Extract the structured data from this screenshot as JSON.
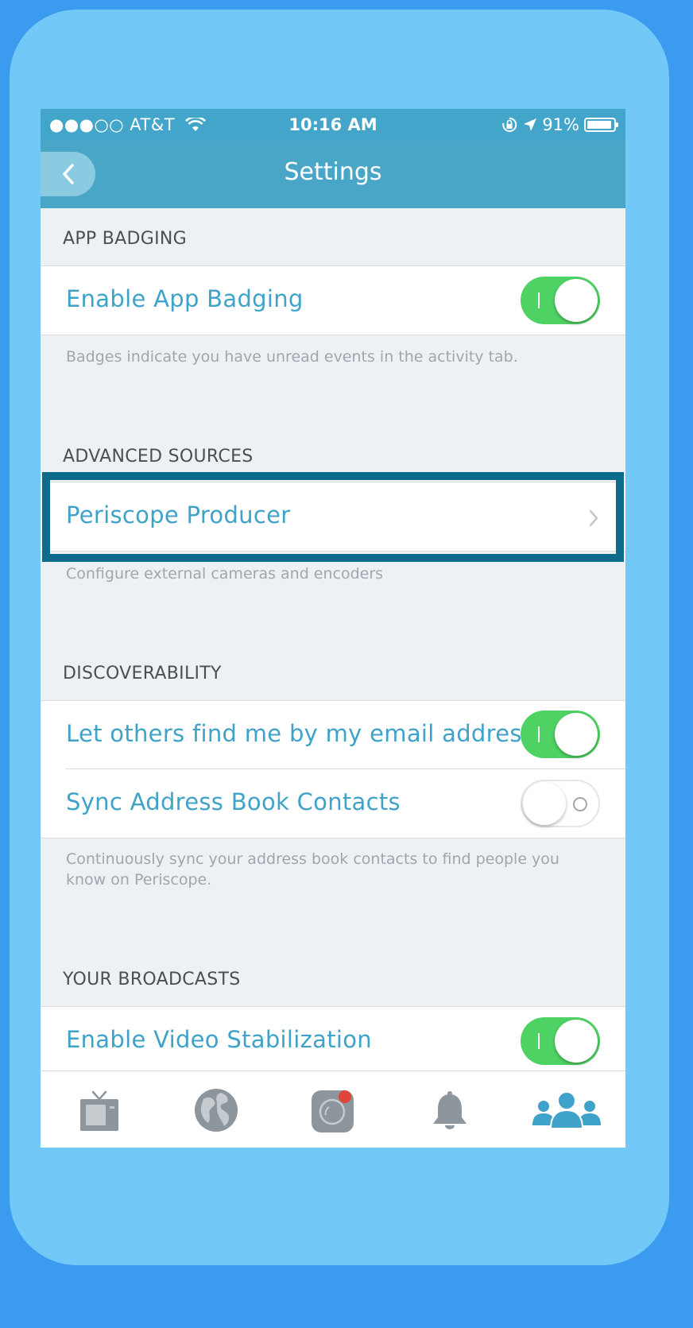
{
  "status_bar": {
    "carrier": "●●●○○ AT&T",
    "time": "10:16 AM",
    "battery_percent": "91%"
  },
  "nav": {
    "title": "Settings",
    "back_icon": "chevron-left-icon"
  },
  "sections": {
    "app_badging": {
      "header": "APP BADGING",
      "row_label": "Enable App Badging",
      "toggle_on": true,
      "footer": "Badges indicate you have unread events in the activity tab."
    },
    "advanced_sources": {
      "header": "ADVANCED SOURCES",
      "row_label": "Periscope Producer",
      "footer": "Configure external cameras and encoders"
    },
    "discoverability": {
      "header": "DISCOVERABILITY",
      "row1_label": "Let others find me by my email address",
      "row1_toggle_on": true,
      "row2_label": "Sync Address Book Contacts",
      "row2_toggle_on": false,
      "footer": "Continuously sync your address book contacts to find people you know on Periscope."
    },
    "your_broadcasts": {
      "header": "YOUR BROADCASTS",
      "row_label": "Enable Video Stabilization",
      "toggle_on": true
    }
  },
  "tabs": [
    {
      "icon": "tv-icon",
      "active": false
    },
    {
      "icon": "globe-icon",
      "active": false
    },
    {
      "icon": "camera-broadcast-icon",
      "active": false
    },
    {
      "icon": "bell-icon",
      "active": false
    },
    {
      "icon": "people-icon",
      "active": true
    }
  ],
  "colors": {
    "accent": "#3fa2c9",
    "nav_bar": "#4aa6c6",
    "toggle_on": "#4fd264",
    "highlight": "#0d6c8c",
    "frame_bg": "#72c8f6",
    "page_bg": "#3a9bef"
  }
}
